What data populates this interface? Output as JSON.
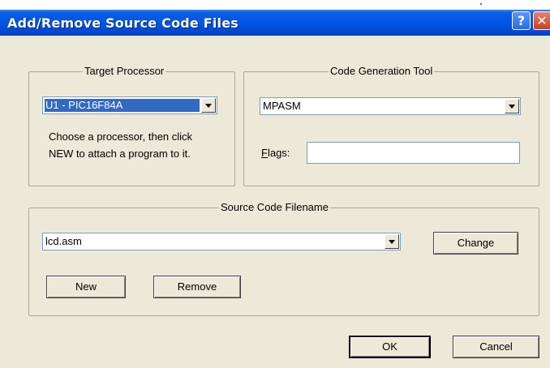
{
  "dialog": {
    "title": "Add/Remove Source Code Files",
    "help_button": "?",
    "close_button": "✕"
  },
  "target_processor": {
    "group_label": "Target Processor",
    "selected": "U1 - PIC16F84A",
    "hint_line1": "Choose a processor, then click",
    "hint_line2": "NEW to attach a program to it."
  },
  "code_generation_tool": {
    "group_label": "Code Generation Tool",
    "selected": "MPASM",
    "flags_label": "Flags:",
    "flags_value": ""
  },
  "source_code": {
    "group_label": "Source Code Filename",
    "selected": "lcd.asm",
    "change_button": "Change",
    "new_button": "New",
    "remove_button": "Remove"
  },
  "footer": {
    "ok_button": "OK",
    "cancel_button": "Cancel"
  },
  "icons": {
    "dropdown": "chevron-down-icon",
    "help": "help-icon",
    "close": "close-icon"
  },
  "colors": {
    "titlebar": "#0055e5",
    "dialog_bg": "#ece9d8",
    "selection": "#316ac5"
  }
}
